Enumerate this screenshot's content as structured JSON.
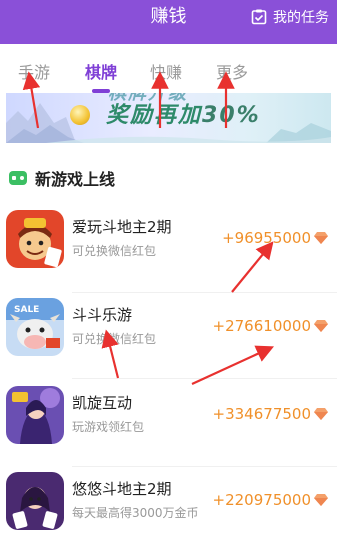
{
  "header": {
    "title": "赚钱",
    "task_label": "我的任务"
  },
  "tabs": [
    {
      "label": "手游",
      "active": false
    },
    {
      "label": "棋牌",
      "active": true
    },
    {
      "label": "快赚",
      "active": false
    },
    {
      "label": "更多",
      "active": false
    }
  ],
  "banner": {
    "text_line1": "棋牌升级",
    "text_line2": "奖励再加",
    "percent": "30%"
  },
  "section": {
    "title": "新游戏上线",
    "icon": "gamepad-icon"
  },
  "games": [
    {
      "name": "爱玩斗地主2期",
      "desc": "可兑换微信红包",
      "reward": "+96955000"
    },
    {
      "name": "斗斗乐游",
      "desc": "可兑换微信红包",
      "reward": "+276610000"
    },
    {
      "name": "凯旋互动",
      "desc": "玩游戏领红包",
      "reward": "+334677500"
    },
    {
      "name": "悠悠斗地主2期",
      "desc": "每天最高得3000万金币",
      "reward": "+220975000"
    }
  ],
  "colors": {
    "accent": "#8a50d8",
    "active_tab": "#7f3fd6",
    "reward": "#f0902a",
    "arrow": "#e8312f"
  }
}
